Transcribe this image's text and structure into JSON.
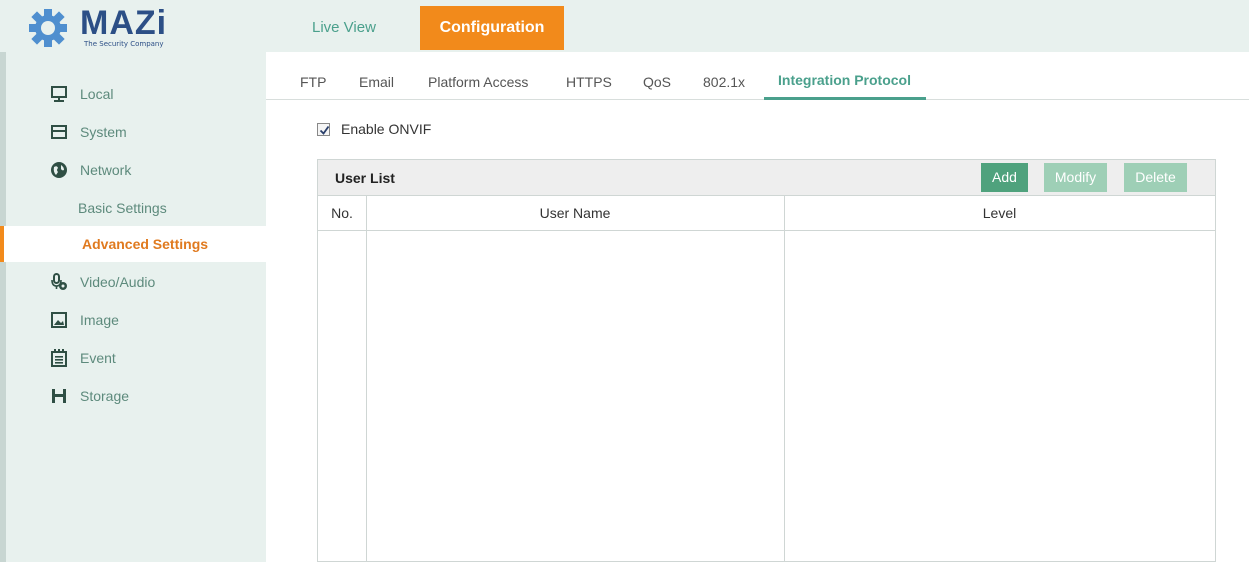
{
  "logo": {
    "name": "MAZi",
    "tagline": "The Security Company"
  },
  "top_tabs": [
    {
      "label": "Live View",
      "active": false
    },
    {
      "label": "Configuration",
      "active": true
    }
  ],
  "sidebar": {
    "items": [
      {
        "label": "Local",
        "icon": "monitor-icon"
      },
      {
        "label": "System",
        "icon": "system-icon"
      },
      {
        "label": "Network",
        "icon": "globe-icon"
      },
      {
        "label": "Basic Settings",
        "sub": true
      },
      {
        "label": "Advanced Settings",
        "sub": true,
        "active": true
      },
      {
        "label": "Video/Audio",
        "icon": "microphone-icon"
      },
      {
        "label": "Image",
        "icon": "image-icon"
      },
      {
        "label": "Event",
        "icon": "calendar-icon"
      },
      {
        "label": "Storage",
        "icon": "floppy-icon"
      }
    ]
  },
  "sub_tabs": [
    "FTP",
    "Email",
    "Platform Access",
    "HTTPS",
    "QoS",
    "802.1x",
    "Integration Protocol"
  ],
  "active_sub_tab": "Integration Protocol",
  "onvif": {
    "label": "Enable ONVIF",
    "checked": true
  },
  "user_list": {
    "title": "User List",
    "buttons": {
      "add": "Add",
      "modify": "Modify",
      "delete": "Delete"
    },
    "columns": [
      "No.",
      "User Name",
      "Level"
    ],
    "rows": []
  },
  "colors": {
    "accent_orange": "#f28a1b",
    "accent_green": "#4aa08c",
    "logo_blue": "#2c4f86"
  }
}
